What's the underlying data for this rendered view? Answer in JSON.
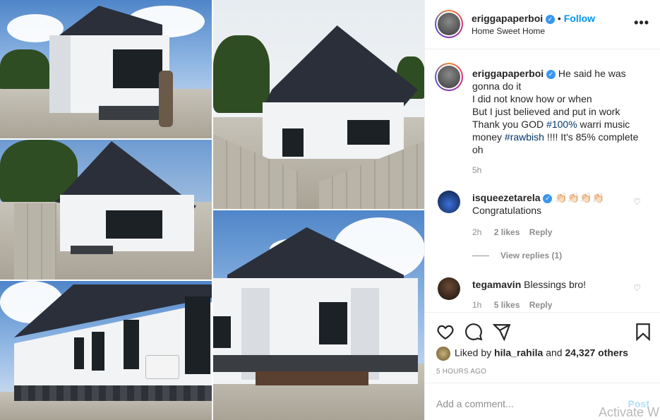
{
  "post": {
    "username": "eriggapaperboi",
    "location": "Home Sweet Home",
    "follow_label": "Follow",
    "more_label": "•••"
  },
  "caption": {
    "username": "eriggapaperboi",
    "line1": "He said he was",
    "line2": "gonna do it",
    "line3": "I did not know how or when",
    "line4": "But I just believed and put in work",
    "line5_a": "Thank you GOD ",
    "hashtag1": "#100%",
    "line5_b": " warri music",
    "line6_a": "money ",
    "hashtag2": "#rawbish",
    "line6_b": " !!!! It's 85% complete",
    "line7": "oh",
    "age": "5h"
  },
  "comments": [
    {
      "username": "isqueezetarela",
      "emoji": "👏🏻👏🏻👏🏻👏🏻",
      "text": "Congratulations",
      "age": "2h",
      "likes": "2 likes",
      "reply": "Reply",
      "view_replies": "View replies (1)"
    },
    {
      "username": "tegamavin",
      "text": "Blessings bro!",
      "age": "1h",
      "likes": "5 likes",
      "reply": "Reply"
    }
  ],
  "likes": {
    "prefix": "Liked by ",
    "user": "hila_rahila",
    "middle": " and ",
    "count": "24,327 others"
  },
  "timestamp": "5 HOURS AGO",
  "add_comment": {
    "placeholder": "Add a comment...",
    "post_label": "Post"
  },
  "watermark": "Activate W",
  "icons": {
    "like": "heart-icon",
    "comment": "comment-icon",
    "share": "paper-plane-icon",
    "save": "bookmark-icon",
    "verified": "verified-badge-icon"
  },
  "colors": {
    "link": "#0095f6",
    "hashtag": "#00376b",
    "verified": "#3897f0",
    "muted": "#8e8e8e"
  }
}
